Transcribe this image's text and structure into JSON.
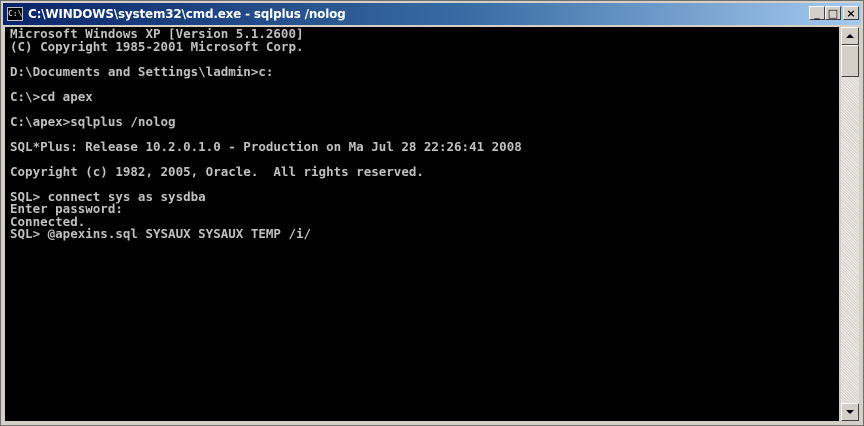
{
  "window": {
    "title": "C:\\WINDOWS\\system32\\cmd.exe - sqlplus /nolog",
    "icon_label": "C:\\",
    "minimize_label": "_",
    "maximize_label": "□",
    "close_label": "×"
  },
  "console": {
    "lines": [
      "Microsoft Windows XP [Version 5.1.2600]",
      "(C) Copyright 1985-2001 Microsoft Corp.",
      "",
      "D:\\Documents and Settings\\ladmin>c:",
      "",
      "C:\\>cd apex",
      "",
      "C:\\apex>sqlplus /nolog",
      "",
      "SQL*Plus: Release 10.2.0.1.0 - Production on Ma Jul 28 22:26:41 2008",
      "",
      "Copyright (c) 1982, 2005, Oracle.  All rights reserved.",
      "",
      "SQL> connect sys as sysdba",
      "Enter password:",
      "Connected.",
      "SQL> @apexins.sql SYSAUX SYSAUX TEMP /i/"
    ]
  },
  "colors": {
    "console_bg": "#000000",
    "console_fg": "#c0c0c0",
    "title_active": "#0a246a"
  },
  "icons": {
    "app": "cmd-icon",
    "minimize": "minimize-icon",
    "maximize": "maximize-icon",
    "close": "close-icon",
    "scroll_up": "scroll-up-icon",
    "scroll_down": "scroll-down-icon"
  }
}
